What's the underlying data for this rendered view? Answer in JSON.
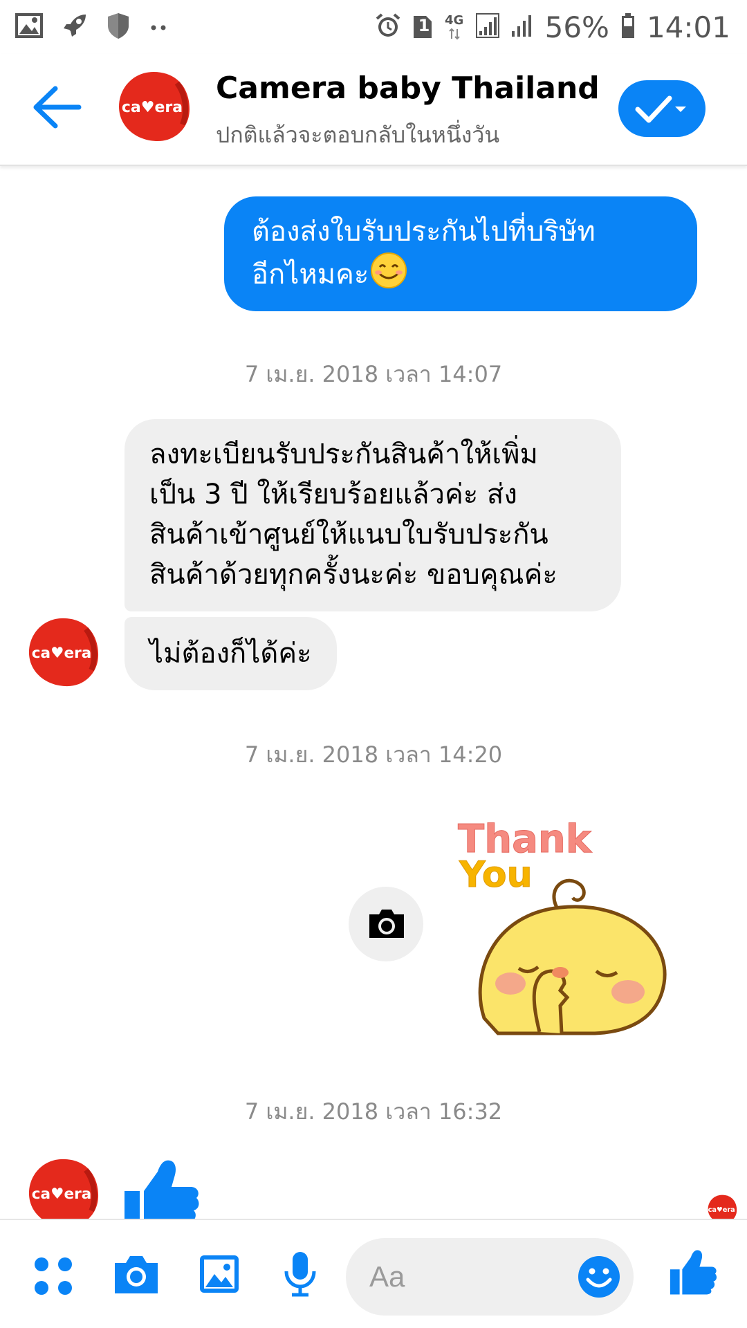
{
  "status_bar": {
    "signal_label": "4G",
    "sim_badge": "1",
    "battery": "56%",
    "time": "14:01",
    "icons": [
      "gallery-icon",
      "rocket-icon",
      "shield-icon",
      "dots-icon",
      "alarm-icon",
      "sim-icon",
      "network-4g-icon",
      "signal-icon",
      "battery-icon"
    ]
  },
  "header": {
    "title": "Camera baby Thailand",
    "subtitle": "ปกติแล้วจะตอบกลับในหนึ่งวัน",
    "avatar_text": "camera",
    "brand_color": "#e4291c",
    "accent_color": "#0a84f6"
  },
  "messages": {
    "outgoing_1_line1": "ต้องส่งใบรับประกันไปที่บริษัท",
    "outgoing_1_line2": "อีกไหมคะ",
    "outgoing_1_emoji": "😊",
    "timestamp_1": "7 เม.ย. 2018 เวลา 14:07",
    "incoming_1_lines": [
      "ลงทะเบียนรับประกันสินค้าให้เพิ่ม",
      "เป็น 3 ปี ให้เรียบร้อยแล้วค่ะ ส่ง",
      "สินค้าเข้าศูนย์ให้แนบใบรับประกัน",
      "สินค้าด้วยทุกครั้งนะค่ะ ขอบคุณค่ะ"
    ],
    "incoming_2": "ไม่ต้องก็ได้ค่ะ",
    "timestamp_2": "7 เม.ย. 2018 เวลา 14:20",
    "sticker_line1": "Thank",
    "sticker_line2": "You",
    "timestamp_3": "7 เม.ย. 2018 เวลา 16:32"
  },
  "composer": {
    "placeholder": "Aa",
    "icons": [
      "apps-icon",
      "camera-icon",
      "image-icon",
      "mic-icon",
      "emoji-icon",
      "like-icon"
    ]
  }
}
